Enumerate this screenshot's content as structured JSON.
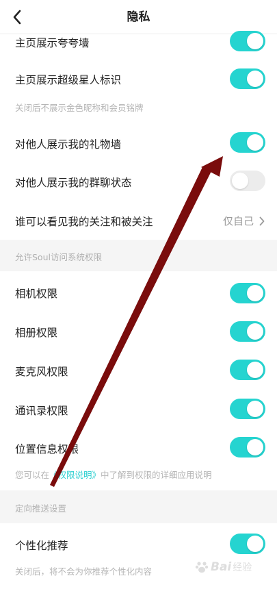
{
  "header": {
    "title": "隐私"
  },
  "rows": {
    "kuakua_wall": {
      "label": "主页展示夸夸墙",
      "on": true
    },
    "super_star": {
      "label": "主页展示超级星人标识",
      "on": true,
      "note": "关闭后不展示金色昵称和会员铭牌"
    },
    "gift_wall": {
      "label": "对他人展示我的礼物墙",
      "on": true
    },
    "group_status": {
      "label": "对他人展示我的群聊状态",
      "on": false
    },
    "follow_visibility": {
      "label": "谁可以看见我的关注和被关注",
      "value": "仅自己"
    }
  },
  "sections": {
    "system_permissions": {
      "title": "允许Soul访问系统权限",
      "items": [
        {
          "label": "相机权限",
          "on": true
        },
        {
          "label": "相册权限",
          "on": true
        },
        {
          "label": "麦克风权限",
          "on": true
        },
        {
          "label": "通讯录权限",
          "on": true
        },
        {
          "label": "位置信息权限",
          "on": true
        }
      ],
      "note_prefix": "您可以在",
      "note_link": "《权限说明》",
      "note_suffix": "中了解到权限的详细应用说明"
    },
    "targeted_push": {
      "title": "定向推送设置",
      "items": [
        {
          "label": "个性化推荐",
          "on": true
        }
      ],
      "note": "关闭后，将不会为你推荐个性化内容"
    }
  },
  "watermark": {
    "text": "Bai",
    "sub": "经验"
  },
  "colors": {
    "toggle_on": "#25d4d0",
    "toggle_off": "#ececec",
    "link": "#2bcfd0",
    "arrow": "#7a0c0c"
  }
}
